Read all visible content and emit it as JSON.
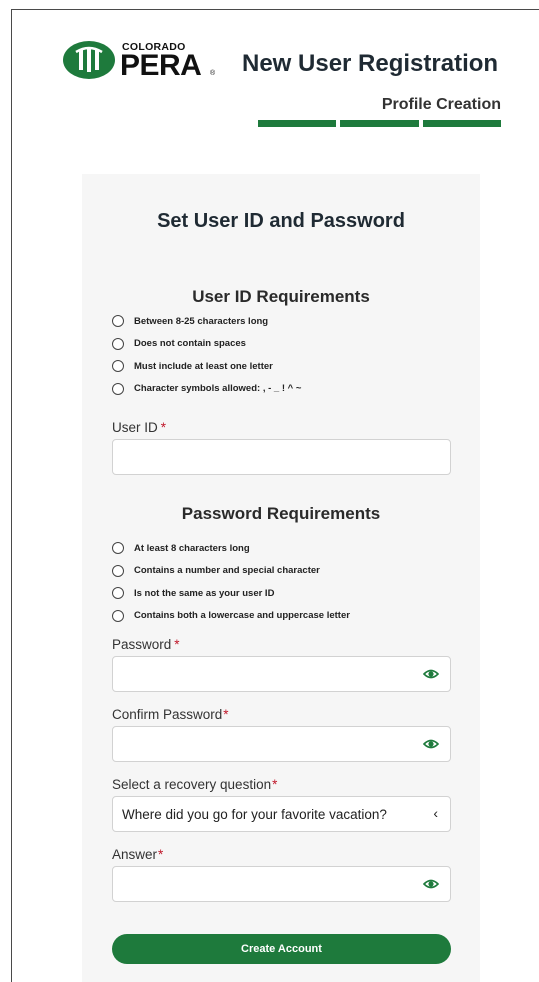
{
  "brand": {
    "logo_small": "COLORADO",
    "logo_large": "PERA",
    "logo_reg": "®"
  },
  "header": {
    "title": "New User Registration",
    "step": "Profile Creation",
    "progress_steps": 3,
    "accent_color": "#1e7a3c"
  },
  "form": {
    "title": "Set User ID and Password",
    "user_id_requirements": {
      "heading": "User ID Requirements",
      "items": [
        "Between 8-25 characters long",
        "Does not contain spaces",
        "Must include at least one letter",
        "Character symbols allowed: , - _ ! ^ ~"
      ]
    },
    "user_id": {
      "label": "User ID",
      "required_mark": "*",
      "value": ""
    },
    "password_requirements": {
      "heading": "Password Requirements",
      "items": [
        "At least 8 characters long",
        "Contains a number and special character",
        "Is not the same as your user ID",
        "Contains both a lowercase and uppercase letter"
      ]
    },
    "password": {
      "label": "Password",
      "required_mark": "*",
      "value": "",
      "toggle_icon": "eye-icon"
    },
    "confirm_password": {
      "label": "Confirm Password",
      "required_mark": "*",
      "value": "",
      "toggle_icon": "eye-icon"
    },
    "recovery_question": {
      "label": "Select a recovery question",
      "required_mark": "*",
      "selected": "Where did you go for your favorite vacation?",
      "chevron": "‹"
    },
    "answer": {
      "label": "Answer",
      "required_mark": "*",
      "value": "",
      "toggle_icon": "eye-icon"
    },
    "submit_label": "Create Account"
  }
}
